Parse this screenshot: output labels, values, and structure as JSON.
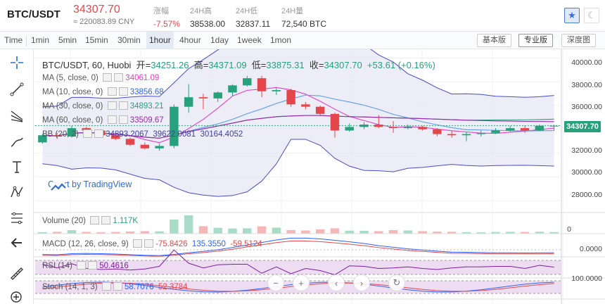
{
  "header": {
    "pair": "BTC/USDT",
    "price": "34307.70",
    "cny": "≈ 220083.89 CNY",
    "stats": [
      {
        "label": "涨幅",
        "value": "-7.57%",
        "red": true
      },
      {
        "label": "24H高",
        "value": "38538.00"
      },
      {
        "label": "24H低",
        "value": "32837.11"
      },
      {
        "label": "24H量",
        "value": "72,540 BTC"
      }
    ],
    "icons": [
      "star-icon",
      "moon-icon"
    ]
  },
  "toolbar": {
    "timeframes": [
      "Time",
      "1min",
      "5min",
      "15min",
      "30min",
      "1hour",
      "4hour",
      "1day",
      "1week",
      "1mon"
    ],
    "active_timeframe": "1hour",
    "versions": [
      "基本版",
      "专业版",
      "深度图"
    ],
    "active_version": "专业版"
  },
  "left_tools": [
    "crosshair-icon",
    "trendline-icon",
    "pitchfork-icon",
    "brush-icon",
    "text-icon",
    "pattern-icon",
    "fib-icon",
    "back-arrow-icon",
    "ruler-icon",
    "zoom-in-icon"
  ],
  "main": {
    "title_symbol": "BTC/USDT, 60, Huobi",
    "open_label": "开=",
    "open": "34251.26",
    "high_label": "高=",
    "high": "34371.09",
    "low_label": "低=",
    "low": "33875.31",
    "close_label": "收=",
    "close": "34307.70",
    "change": "+53.61 (+0.16%)",
    "indicators": [
      {
        "label": "MA (5, close, 0)",
        "value": "34061.09",
        "color": "#e040c0"
      },
      {
        "label": "MA (10, close, 0)",
        "value": "33856.68",
        "color": "#2962ff"
      },
      {
        "label": "MA (30, close, 0)",
        "value": "34893.21",
        "color": "#26a17b"
      },
      {
        "label": "MA (60, close, 0)",
        "value": "33509.67",
        "color": "#9c27b0"
      },
      {
        "label": "BB (20, 2)",
        "value": "34893.2067",
        "value2": "39622.0081",
        "value3": "30164.4052",
        "color": "#4040a0"
      }
    ],
    "watermark": "Chart by TradingView",
    "price_axis": [
      "40000.00",
      "38000.00",
      "36000.00",
      "34000.00",
      "32000.00",
      "30000.00",
      "28000.00"
    ],
    "last_price": "34307.70"
  },
  "volume": {
    "label": "Volume (20)",
    "value": "1.117K",
    "axis": "0"
  },
  "macd": {
    "label": "MACD (12, 26, close, 9)",
    "v1": "-75.8426",
    "v2": "135.3550",
    "v3": "-59.5124",
    "axis": "0.0000"
  },
  "rsi": {
    "label": "RSI (14)",
    "value": "50.4616"
  },
  "stoch": {
    "label": "Stoch (14, 1, 3)",
    "v1": "58.7076",
    "v2": "52.3784",
    "axis": "100.0000"
  },
  "colors": {
    "up": "#26a17b",
    "down": "#e4474b",
    "accent": "#2b6ed1"
  },
  "chart_data": {
    "type": "candlestick",
    "ylim": [
      27000,
      40500
    ],
    "candles": [
      {
        "o": 32900,
        "c": 33500,
        "h": 33600,
        "l": 32800
      },
      {
        "o": 33500,
        "c": 33400,
        "h": 33700,
        "l": 33200
      },
      {
        "o": 33400,
        "c": 34100,
        "h": 34300,
        "l": 33300
      },
      {
        "o": 34100,
        "c": 33900,
        "h": 34200,
        "l": 33700
      },
      {
        "o": 33900,
        "c": 33500,
        "h": 34000,
        "l": 33400
      },
      {
        "o": 33500,
        "c": 33200,
        "h": 33700,
        "l": 33100
      },
      {
        "o": 33200,
        "c": 32700,
        "h": 33300,
        "l": 32600
      },
      {
        "o": 32700,
        "c": 32400,
        "h": 32900,
        "l": 32300
      },
      {
        "o": 32400,
        "c": 32600,
        "h": 32800,
        "l": 32200
      },
      {
        "o": 32600,
        "c": 35900,
        "h": 36100,
        "l": 32400
      },
      {
        "o": 35900,
        "c": 36700,
        "h": 37800,
        "l": 35400
      },
      {
        "o": 36700,
        "c": 36600,
        "h": 37000,
        "l": 35700
      },
      {
        "o": 36600,
        "c": 37100,
        "h": 37200,
        "l": 36300
      },
      {
        "o": 37100,
        "c": 37700,
        "h": 37800,
        "l": 36800
      },
      {
        "o": 37700,
        "c": 38300,
        "h": 38500,
        "l": 37600
      },
      {
        "o": 38300,
        "c": 37200,
        "h": 38500,
        "l": 36700
      },
      {
        "o": 37200,
        "c": 37300,
        "h": 37500,
        "l": 36900
      },
      {
        "o": 37300,
        "c": 36100,
        "h": 37400,
        "l": 35900
      },
      {
        "o": 36100,
        "c": 35900,
        "h": 36300,
        "l": 35700
      },
      {
        "o": 35900,
        "c": 35300,
        "h": 36000,
        "l": 35100
      },
      {
        "o": 35300,
        "c": 33900,
        "h": 35400,
        "l": 33300
      },
      {
        "o": 33900,
        "c": 34200,
        "h": 34500,
        "l": 33800
      },
      {
        "o": 34200,
        "c": 34400,
        "h": 34600,
        "l": 34000
      },
      {
        "o": 34400,
        "c": 34200,
        "h": 35200,
        "l": 34100
      },
      {
        "o": 34200,
        "c": 34100,
        "h": 34700,
        "l": 33700
      },
      {
        "o": 34100,
        "c": 34200,
        "h": 34400,
        "l": 34000
      },
      {
        "o": 34200,
        "c": 34000,
        "h": 34300,
        "l": 33900
      },
      {
        "o": 34000,
        "c": 33600,
        "h": 34100,
        "l": 33400
      },
      {
        "o": 33600,
        "c": 33500,
        "h": 33900,
        "l": 33300
      },
      {
        "o": 33500,
        "c": 33600,
        "h": 33800,
        "l": 33000
      },
      {
        "o": 33600,
        "c": 33700,
        "h": 33900,
        "l": 33400
      },
      {
        "o": 33700,
        "c": 33900,
        "h": 34100,
        "l": 33600
      },
      {
        "o": 33900,
        "c": 34100,
        "h": 34300,
        "l": 33800
      },
      {
        "o": 34100,
        "c": 33900,
        "h": 34300,
        "l": 33700
      },
      {
        "o": 33900,
        "c": 34300,
        "h": 34400,
        "l": 33850
      },
      {
        "o": 34250,
        "c": 34300,
        "h": 34370,
        "l": 33875
      }
    ],
    "volumes": [
      180,
      220,
      420,
      210,
      160,
      200,
      260,
      300,
      280,
      1700,
      2200,
      900,
      700,
      620,
      640,
      880,
      720,
      430,
      380,
      520,
      640,
      360,
      340,
      300,
      420,
      380,
      300,
      240,
      220,
      180,
      160,
      200,
      220,
      200,
      230,
      190
    ]
  }
}
